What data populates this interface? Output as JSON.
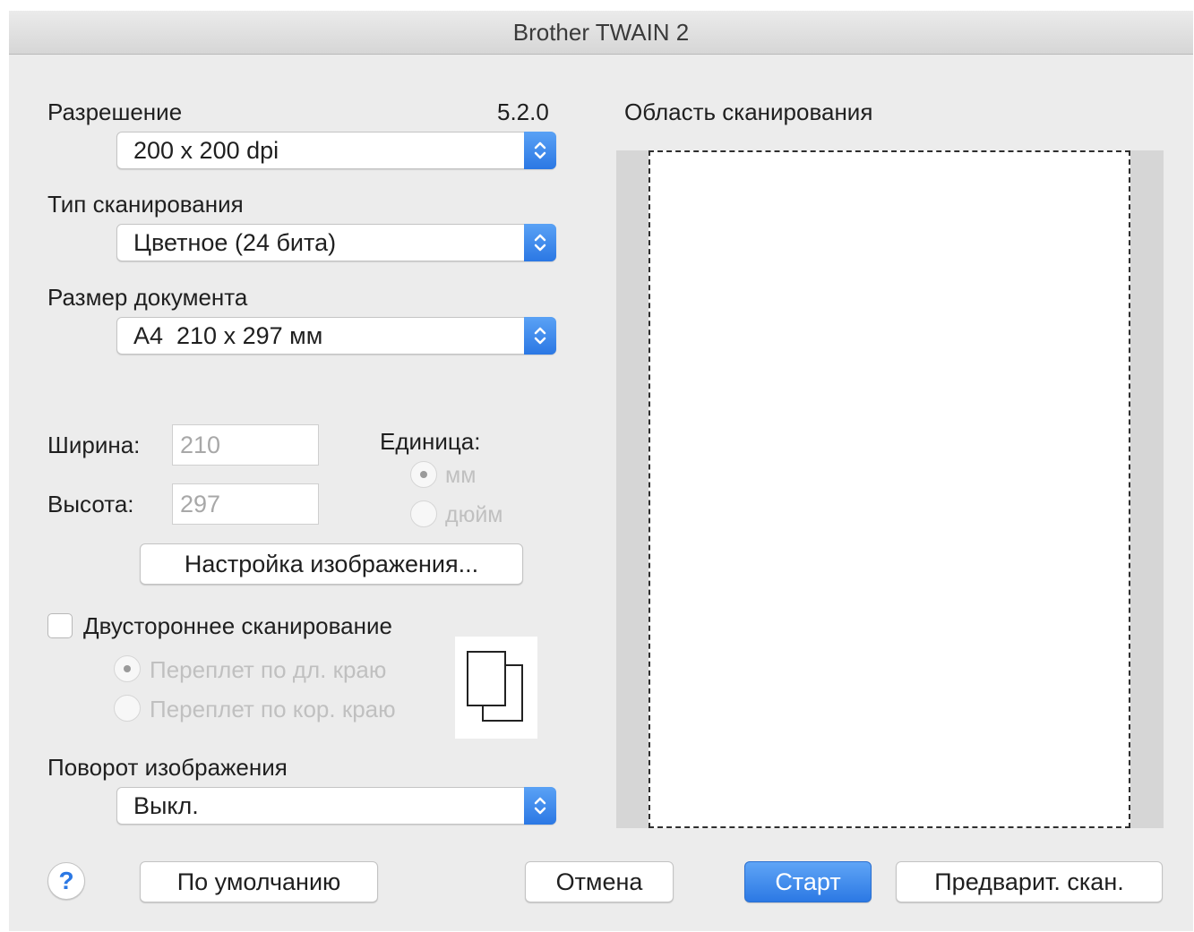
{
  "window": {
    "title": "Brother TWAIN 2"
  },
  "version": "5.2.0",
  "resolution": {
    "label": "Разрешение",
    "value": "200 x 200 dpi"
  },
  "scan_type": {
    "label": "Тип сканирования",
    "value": "Цветное (24 бита)"
  },
  "document_size": {
    "label": "Размер документа",
    "value": "A4  210 x 297 мм"
  },
  "width": {
    "label": "Ширина:",
    "value": "210"
  },
  "height": {
    "label": "Высота:",
    "value": "297"
  },
  "unit": {
    "label": "Единица:",
    "options": [
      "мм",
      "дюйм"
    ],
    "selected": "мм"
  },
  "image_settings_button": "Настройка изображения...",
  "duplex": {
    "label": "Двустороннее сканирование",
    "checked": false,
    "options": [
      "Переплет по дл. краю",
      "Переплет по кор. краю"
    ],
    "selected": "Переплет по дл. краю"
  },
  "rotation": {
    "label": "Поворот изображения",
    "value": "Выкл."
  },
  "scan_area": {
    "label": "Область сканирования"
  },
  "buttons": {
    "help": "?",
    "default": "По умолчанию",
    "cancel": "Отмена",
    "start": "Старт",
    "preview": "Предварит. скан."
  },
  "icons": {
    "popup_stepper": "up-down-chevron-icon",
    "duplex_preview": "duplex-pages-icon",
    "help": "help-icon"
  },
  "colors": {
    "accent": "#2b78e4",
    "window_bg": "#ececec",
    "scan_area_bg": "#d6d6d6"
  }
}
